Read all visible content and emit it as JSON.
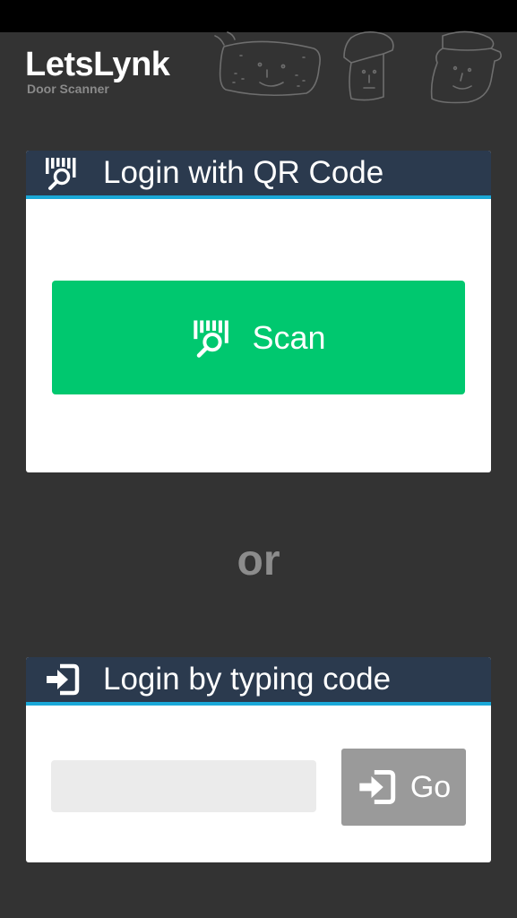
{
  "brand": {
    "title": "LetsLynk",
    "subtitle": "Door Scanner"
  },
  "qr_card": {
    "title": "Login with QR Code",
    "header_icon": "barcode-scan-icon",
    "scan_button": {
      "label": "Scan",
      "icon": "barcode-scan-icon"
    }
  },
  "separator": {
    "text": "or"
  },
  "code_card": {
    "title": "Login by typing code",
    "header_icon": "login-arrow-icon",
    "input": {
      "value": "",
      "placeholder": ""
    },
    "go_button": {
      "label": "Go",
      "icon": "login-arrow-icon"
    }
  },
  "colors": {
    "background": "#333333",
    "card_header": "#2b3a4e",
    "accent": "#1aa8d8",
    "scan_button": "#00c86f",
    "go_button": "#9a9a9a"
  }
}
